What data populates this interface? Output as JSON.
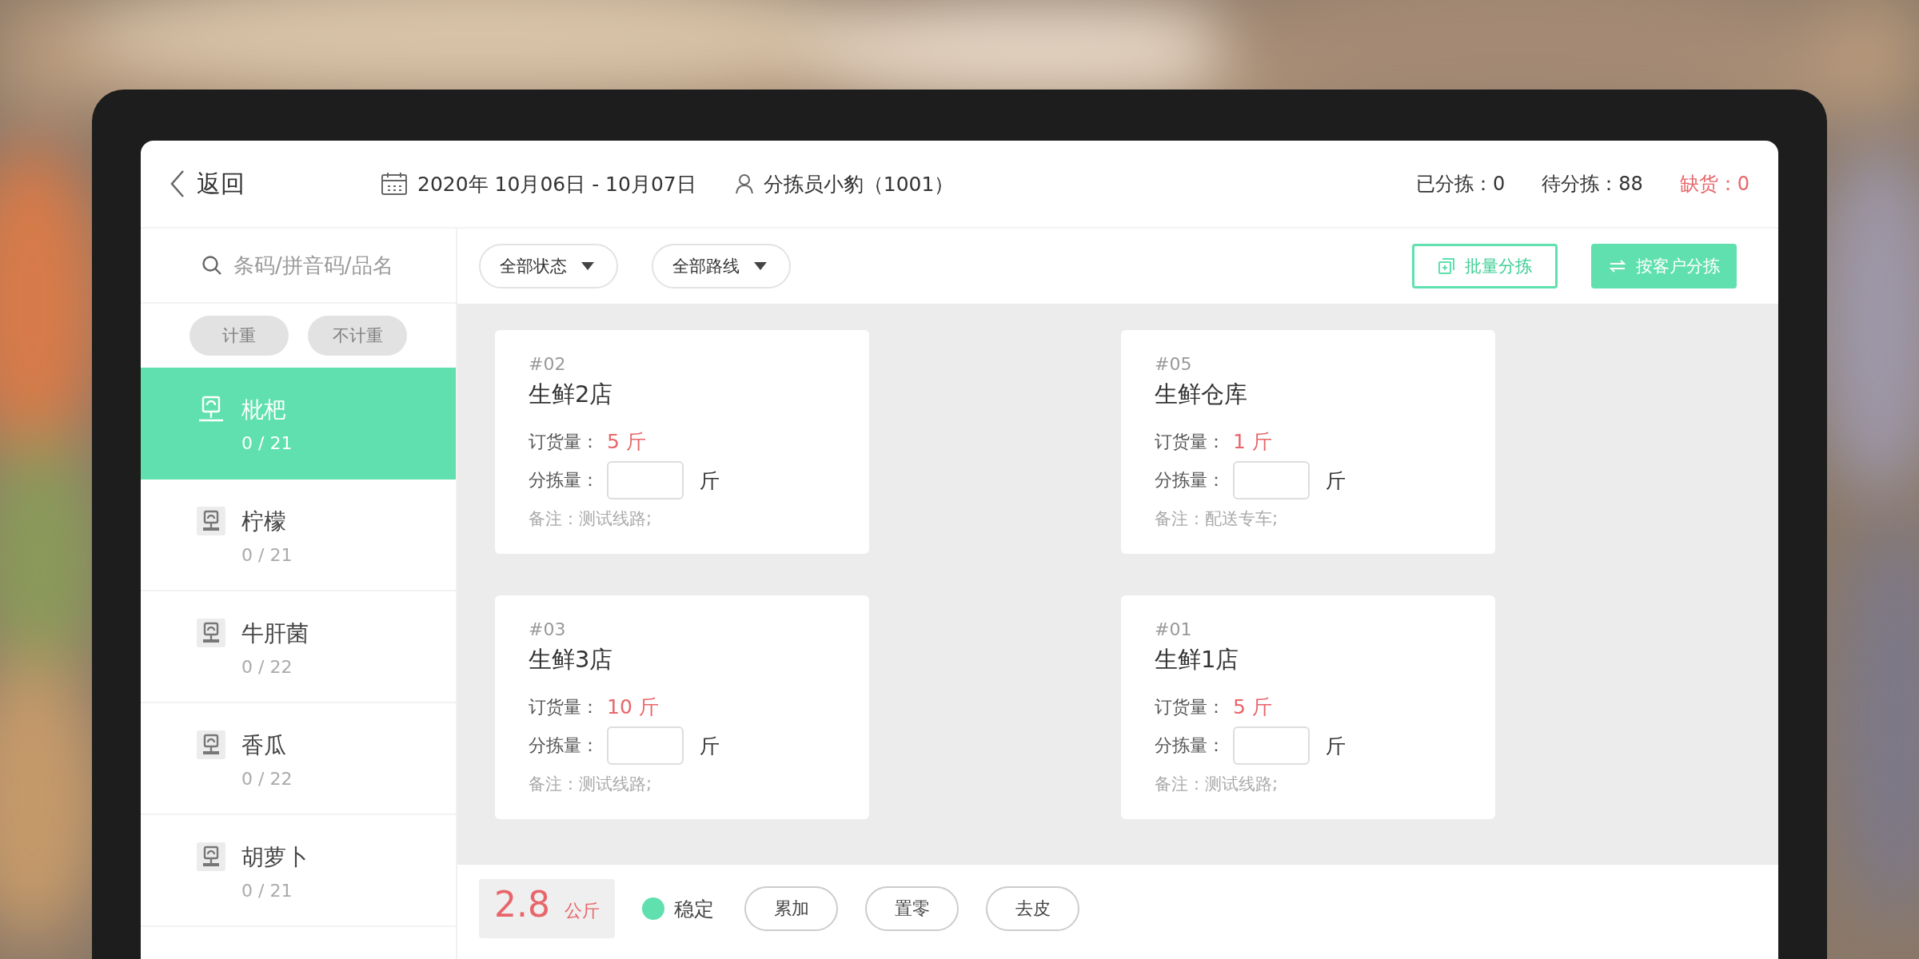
{
  "header": {
    "back": "返回",
    "date_range": "2020年 10月06日 - 10月07日",
    "picker": "分拣员小豹（1001）",
    "stats": [
      {
        "label": "已分拣：0",
        "kind": "normal"
      },
      {
        "label": "待分拣：88",
        "kind": "normal"
      },
      {
        "label": "缺货：0",
        "kind": "alert"
      }
    ]
  },
  "search": {
    "placeholder": "条码/拼音码/品名"
  },
  "weigh_filters": [
    {
      "label": "计重",
      "selected": false
    },
    {
      "label": "不计重",
      "selected": false
    }
  ],
  "products": [
    {
      "name": "枇杷",
      "progress": "0 / 21",
      "selected": true
    },
    {
      "name": "柠檬",
      "progress": "0 / 21",
      "selected": false
    },
    {
      "name": "牛肝菌",
      "progress": "0 / 22",
      "selected": false
    },
    {
      "name": "香瓜",
      "progress": "0 / 22",
      "selected": false
    },
    {
      "name": "胡萝卜",
      "progress": "0 / 21",
      "selected": false
    }
  ],
  "filters": [
    {
      "label": "全部状态"
    },
    {
      "label": "全部路线"
    }
  ],
  "actions": [
    {
      "label": "批量分拣",
      "kind": "outline"
    },
    {
      "label": "按客户分拣",
      "kind": "filled"
    }
  ],
  "orders": [
    {
      "number": "#02",
      "customer": "生鲜2店",
      "order_label": "订货量：",
      "order_qty": "5 斤",
      "sort_label": "分拣量：",
      "unit": "斤",
      "note": "备注：测试线路;"
    },
    {
      "number": "#05",
      "customer": "生鲜仓库",
      "order_label": "订货量：",
      "order_qty": "1 斤",
      "sort_label": "分拣量：",
      "unit": "斤",
      "note": "备注：配送专车;"
    },
    {
      "number": "#03",
      "customer": "生鲜3店",
      "order_label": "订货量：",
      "order_qty": "10 斤",
      "sort_label": "分拣量：",
      "unit": "斤",
      "note": "备注：测试线路;"
    },
    {
      "number": "#01",
      "customer": "生鲜1店",
      "order_label": "订货量：",
      "order_qty": "5 斤",
      "sort_label": "分拣量：",
      "unit": "斤",
      "note": "备注：测试线路;"
    }
  ],
  "scale": {
    "reading": "2.8",
    "unit": "公斤",
    "status": "稳定",
    "stable": true,
    "buttons": [
      "累加",
      "置零",
      "去皮"
    ]
  }
}
